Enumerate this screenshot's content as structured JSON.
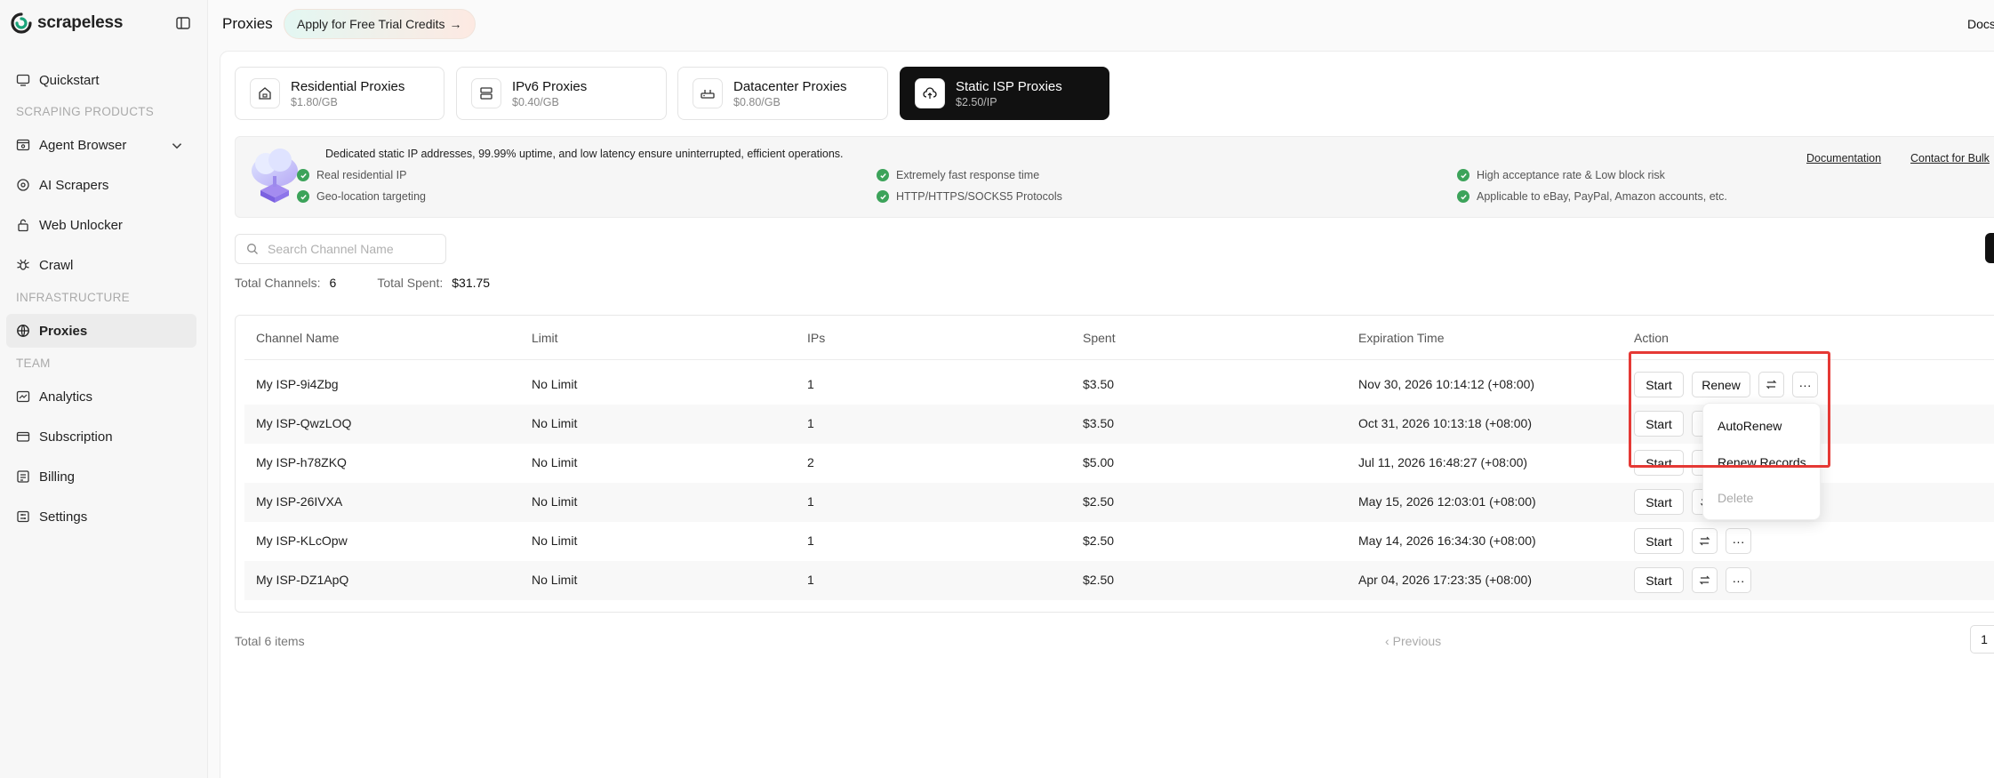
{
  "app": {
    "logo_text": "scrapeless",
    "brand_color": "#1aa37a"
  },
  "sidebar": {
    "items": [
      {
        "label": "Quickstart",
        "icon": "monitor-icon"
      },
      {
        "label": "Agent Browser",
        "icon": "browser-icon"
      },
      {
        "label": "AI Scrapers",
        "icon": "ai-scraper-icon"
      },
      {
        "label": "Web Unlocker",
        "icon": "unlock-icon"
      },
      {
        "label": "Crawl",
        "icon": "spider-icon"
      },
      {
        "label": "Proxies",
        "icon": "globe-icon",
        "active": true
      },
      {
        "label": "Analytics",
        "icon": "analytics-icon"
      },
      {
        "label": "Subscription",
        "icon": "card-icon"
      },
      {
        "label": "Billing",
        "icon": "billing-icon"
      },
      {
        "label": "Settings",
        "icon": "settings-icon"
      }
    ],
    "sections": {
      "scraping_products": "SCRAPING PRODUCTS",
      "infrastructure": "INFRASTRUCTURE",
      "team": "TEAM"
    }
  },
  "header": {
    "title": "Proxies",
    "trial_button": "Apply for Free Trial Credits",
    "trial_arrow": "→",
    "docs_link": "Docs"
  },
  "proxy_tabs": [
    {
      "name": "Residential Proxies",
      "price": "$1.80/GB"
    },
    {
      "name": "IPv6 Proxies",
      "price": "$0.40/GB"
    },
    {
      "name": "Datacenter Proxies",
      "price": "$0.80/GB"
    },
    {
      "name": "Static ISP Proxies",
      "price": "$2.50/IP",
      "active": true
    }
  ],
  "banner": {
    "description": "Dedicated static IP addresses, 99.99% uptime, and low latency ensure uninterrupted, efficient operations.",
    "features": [
      "Real residential IP",
      "Geo-location targeting",
      "Extremely fast response time",
      "HTTP/HTTPS/SOCKS5 Protocols",
      "High acceptance rate & Low block risk",
      "Applicable to eBay, PayPal, Amazon accounts, etc."
    ],
    "documentation_link": "Documentation",
    "contact_link": "Contact for Bulk"
  },
  "search": {
    "placeholder": "Search Channel Name"
  },
  "stats": {
    "total_channels_label": "Total Channels:",
    "total_channels_value": "6",
    "total_spent_label": "Total Spent:",
    "total_spent_value": "$31.75"
  },
  "table": {
    "columns": [
      "Channel Name",
      "Limit",
      "IPs",
      "Spent",
      "Expiration Time",
      "Action"
    ],
    "rows": [
      {
        "name": "My ISP-9i4Zbg",
        "limit": "No Limit",
        "ips": "1",
        "spent": "$3.50",
        "expiration": "Nov 30, 2026 10:14:12 (+08:00)"
      },
      {
        "name": "My ISP-QwzLOQ",
        "limit": "No Limit",
        "ips": "1",
        "spent": "$3.50",
        "expiration": "Oct 31, 2026 10:13:18 (+08:00)"
      },
      {
        "name": "My ISP-h78ZKQ",
        "limit": "No Limit",
        "ips": "2",
        "spent": "$5.00",
        "expiration": "Jul 11, 2026 16:48:27 (+08:00)"
      },
      {
        "name": "My ISP-26IVXA",
        "limit": "No Limit",
        "ips": "1",
        "spent": "$2.50",
        "expiration": "May 15, 2026 12:03:01 (+08:00)"
      },
      {
        "name": "My ISP-KLcOpw",
        "limit": "No Limit",
        "ips": "1",
        "spent": "$2.50",
        "expiration": "May 14, 2026 16:34:30 (+08:00)"
      },
      {
        "name": "My ISP-DZ1ApQ",
        "limit": "No Limit",
        "ips": "1",
        "spent": "$2.50",
        "expiration": "Apr 04, 2026 17:23:35 (+08:00)"
      }
    ],
    "actions": {
      "start": "Start",
      "renew": "Renew",
      "more": "···"
    }
  },
  "dropdown": {
    "items": [
      "AutoRenew",
      "Renew Records",
      "Delete"
    ]
  },
  "footer": {
    "total_items": "Total 6 items",
    "previous": "Previous",
    "page": "1"
  },
  "colors": {
    "highlight": "#e53935",
    "check": "#3ca35a",
    "active_tab": "#111111"
  }
}
